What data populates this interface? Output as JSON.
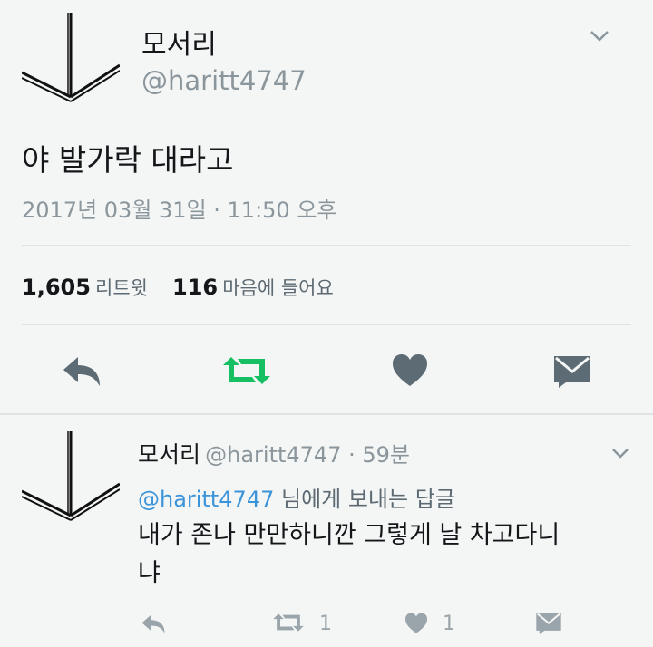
{
  "main_tweet": {
    "display_name": "모서리",
    "handle": "@haritt4747",
    "text": "야 발가락 대라고",
    "timestamp": "2017년 03월 31일 · 11:50 오후",
    "retweet_count": "1,605",
    "retweet_label": "리트윗",
    "like_count": "116",
    "like_label": "마음에 들어요"
  },
  "reply_tweet": {
    "display_name": "모서리",
    "handle_time": "@haritt4747 · 59분",
    "reply_to_mention": "@haritt4747",
    "reply_to_suffix": " 님에게 보내는 답글",
    "text": "내가 존나 만만하니깐 그렇게 날 차고다니냐",
    "retweet_count": "1",
    "like_count": "1"
  },
  "icons": {
    "chevron": "chevron-down-icon",
    "reply": "reply-icon",
    "retweet": "retweet-icon",
    "like": "heart-icon",
    "message": "direct-message-icon"
  },
  "colors": {
    "retweet_active": "#17bf63",
    "icon_gray": "#657786",
    "link_blue": "#3b94d9"
  }
}
